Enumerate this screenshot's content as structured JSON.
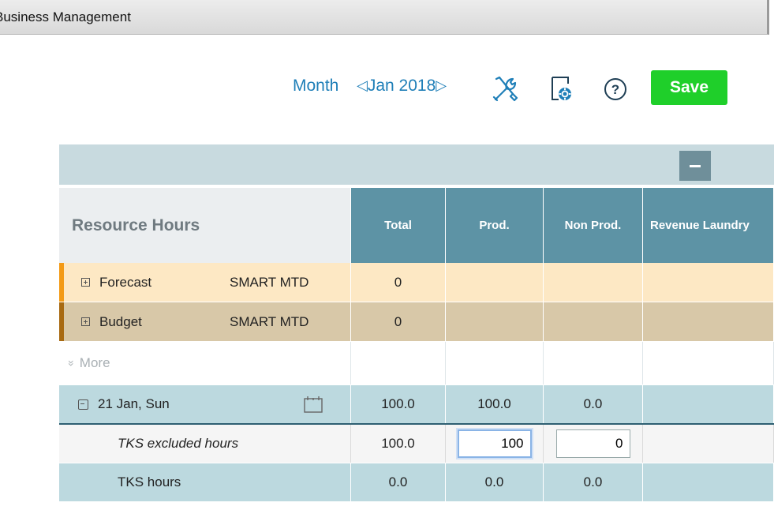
{
  "window": {
    "title": "Business Management"
  },
  "toolbar": {
    "view_mode": "Month",
    "period": "Jan 2018",
    "prev_arrow": "◁",
    "next_arrow": "▷",
    "save_label": "Save",
    "icons": [
      "tools-icon",
      "document-settings-icon",
      "help-icon"
    ]
  },
  "section": {
    "collapse_label": "−"
  },
  "table": {
    "title": "Resource Hours",
    "columns": [
      "Total",
      "Prod.",
      "Non Prod.",
      "Revenue Laundry"
    ],
    "rows": [
      {
        "label": "Forecast",
        "sub": "SMART MTD",
        "total": "0",
        "prod": "",
        "nonprod": "",
        "rev": ""
      },
      {
        "label": "Budget",
        "sub": "SMART MTD",
        "total": "0",
        "prod": "",
        "nonprod": "",
        "rev": ""
      }
    ],
    "more_label": "More",
    "more_icon": "»",
    "day": {
      "label": "21 Jan, Sun",
      "total": "100.0",
      "prod": "100.0",
      "nonprod": "0.0",
      "rev": ""
    },
    "tks_excluded": {
      "label": "TKS excluded hours",
      "total": "100.0",
      "prod_value": "100",
      "nonprod_value": "0"
    },
    "tks_hours": {
      "label": "TKS hours",
      "total": "0.0",
      "prod": "0.0",
      "nonprod": "0.0"
    }
  },
  "colors": {
    "accent_blue": "#1f7fb8",
    "save_green": "#1fcf2a",
    "header_teal": "#5d93a5",
    "forecast_bg": "#fde8c4",
    "forecast_marker": "#f39a16",
    "budget_bg": "#d8c8a8",
    "budget_marker": "#a86a12",
    "day_bg": "#bcd9df"
  }
}
